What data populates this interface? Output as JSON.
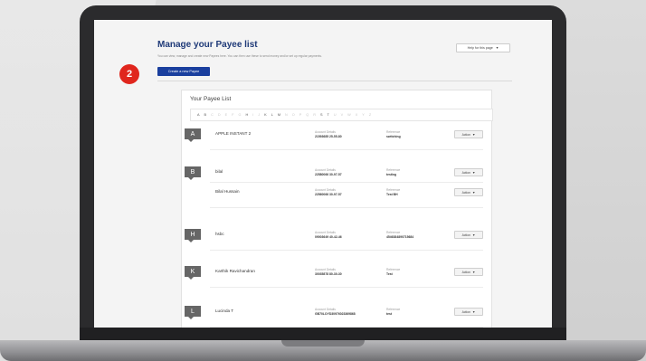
{
  "page": {
    "title": "Manage your Payee list",
    "subtitle": "You can view, manage and create new Payees here. You can then use these to send money and/or set up regular payments.",
    "help_label": "Help for this page",
    "help_caret": "▼",
    "create_label": "Create a new Payee",
    "step_number": "2"
  },
  "payee_list": {
    "title": "Your Payee List",
    "alphabet": [
      "A",
      "B",
      "C",
      "D",
      "E",
      "F",
      "G",
      "H",
      "I",
      "J",
      "K",
      "L",
      "M",
      "N",
      "O",
      "P",
      "Q",
      "R",
      "S",
      "T",
      "U",
      "V",
      "W",
      "X",
      "Y",
      "Z"
    ],
    "active_letters": [
      "A",
      "B",
      "H",
      "K",
      "L",
      "M",
      "S",
      "T"
    ],
    "groups": [
      {
        "letter": "A",
        "rows": [
          {
            "name": "APPLE INSTANT 2",
            "account_label": "Account Details",
            "account": "21593685 25-55-80",
            "reference_label": "Reference",
            "reference": "switching",
            "action": "Action"
          }
        ]
      },
      {
        "letter": "B",
        "rows": [
          {
            "name": "bilal",
            "account_label": "Account Details",
            "account": "22580066 30-97-57",
            "reference_label": "Reference",
            "reference": "testing",
            "action": "Action"
          },
          {
            "name": "Bilal Hussain",
            "account_label": "Account Details",
            "account": "22560066 30-97-57",
            "reference_label": "Reference",
            "reference": "Test BH",
            "action": "Action"
          }
        ]
      },
      {
        "letter": "H",
        "rows": [
          {
            "name": "hsbc",
            "account_label": "Account Details",
            "account": "09003649 40-42-46",
            "reference_label": "Reference",
            "reference": "4546384890715684",
            "action": "Action"
          }
        ]
      },
      {
        "letter": "K",
        "rows": [
          {
            "name": "Karthik Ravichandran",
            "account_label": "Account Details",
            "account": "30035878 80-30-30",
            "reference_label": "Reference",
            "reference": "Test",
            "action": "Action"
          }
        ]
      },
      {
        "letter": "L",
        "rows": [
          {
            "name": "Lucinda T",
            "account_label": "Account Details",
            "account": "GB70LOYD30976023369868",
            "reference_label": "Reference",
            "reference": "test",
            "action": "Action"
          }
        ]
      }
    ],
    "action_caret": "▼"
  },
  "colors": {
    "brand_blue": "#1a3f9e",
    "title_blue": "#1f3a78",
    "badge_red": "#e0261d"
  }
}
